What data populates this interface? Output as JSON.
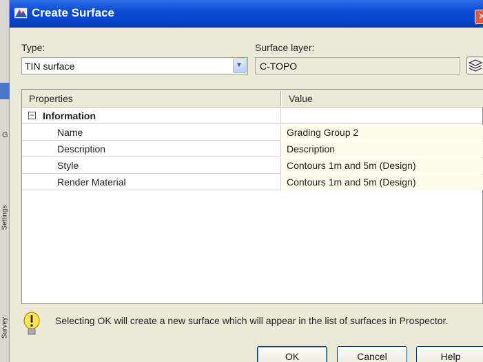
{
  "dialog": {
    "title": "Create Surface"
  },
  "type": {
    "label": "Type:",
    "value": "TIN surface"
  },
  "surface_layer": {
    "label": "Surface layer:",
    "value": "C-TOPO"
  },
  "grid": {
    "headers": {
      "properties": "Properties",
      "value": "Value"
    },
    "group": {
      "label": "Information",
      "expander": "−"
    },
    "rows": [
      {
        "name": "Name",
        "value": "Grading Group 2"
      },
      {
        "name": "Description",
        "value": "Description"
      },
      {
        "name": "Style",
        "value": "Contours 1m and 5m (Design)"
      },
      {
        "name": "Render Material",
        "value": "Contours 1m and 5m (Design)"
      }
    ]
  },
  "info": {
    "message": "Selecting OK will create a new surface which will appear in the list of surfaces in Prospector."
  },
  "buttons": {
    "ok": "OK",
    "cancel": "Cancel",
    "help": "Help"
  },
  "background_app": {
    "side_label_top": "Settings",
    "side_label_bottom": "Survey",
    "mark": "G"
  },
  "icons": {
    "title": "civil-3d-app-icon",
    "combo": "chevron-down-icon",
    "layer_button": "layers-icon",
    "info": "lightbulb-icon",
    "close": "close-icon"
  }
}
